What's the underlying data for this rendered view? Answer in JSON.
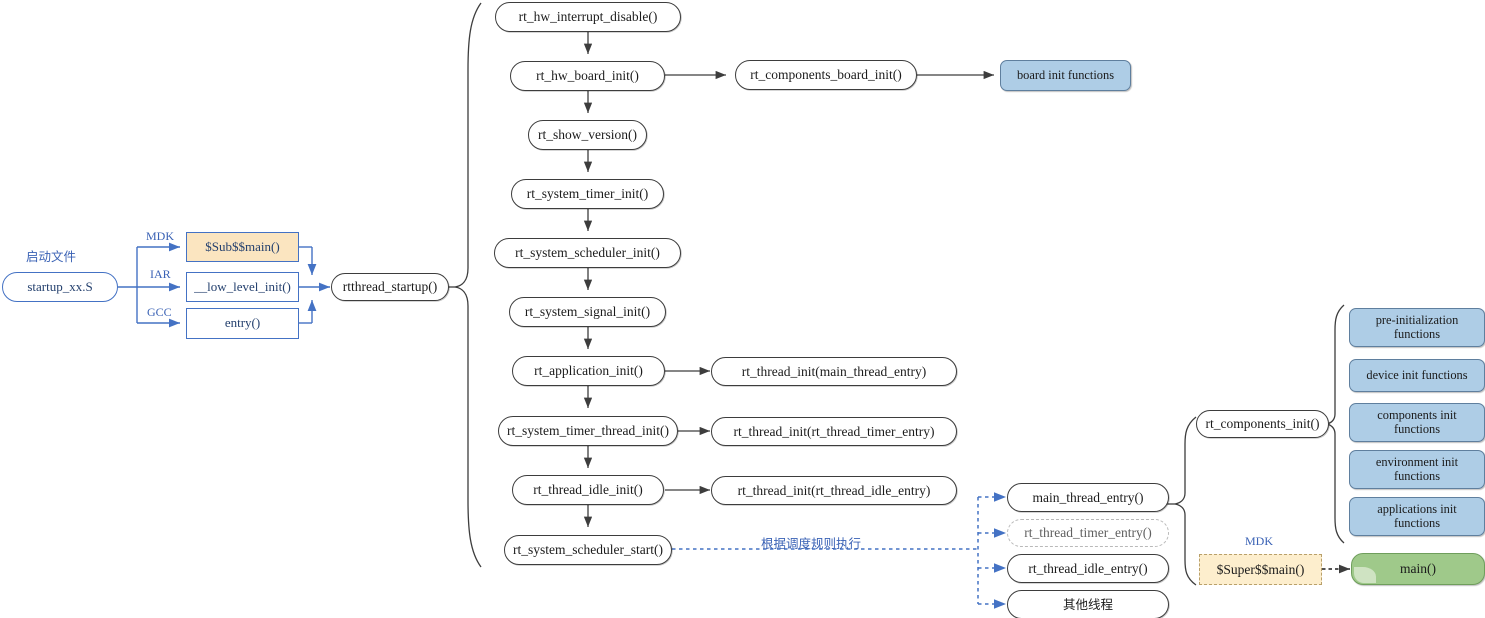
{
  "diagram": {
    "title": "RT-Thread startup flow",
    "colors": {
      "flow_arrow": "#3d3d3d",
      "blue_arrow": "#4472c4",
      "dotted_blue": "#4472c4",
      "blue_fill": "#aecde6",
      "green_fill": "#9fc98a",
      "yellow_fill": "#fbe5c0",
      "label_blue": "#3a62b5"
    }
  },
  "startup": {
    "file_label": "启动文件",
    "file_node": "startup_xx.S",
    "toolchains": [
      {
        "label": "MDK",
        "node": "$Sub$$main()"
      },
      {
        "label": "IAR",
        "node": "__low_level_init()"
      },
      {
        "label": "GCC",
        "node": "entry()"
      }
    ],
    "entry_node": "rtthread_startup()"
  },
  "main_flow": [
    "rt_hw_interrupt_disable()",
    "rt_hw_board_init()",
    "rt_show_version()",
    "rt_system_timer_init()",
    "rt_system_scheduler_init()",
    "rt_system_signal_init()",
    "rt_application_init()",
    "rt_system_timer_thread_init()",
    "rt_thread_idle_init()",
    "rt_system_scheduler_start()"
  ],
  "side_calls": {
    "board_init": "rt_components_board_init()",
    "board_init_functions": "board init functions",
    "thread_inits": [
      "rt_thread_init(main_thread_entry)",
      "rt_thread_init(rt_thread_timer_entry)",
      "rt_thread_init(rt_thread_idle_entry)"
    ]
  },
  "scheduler": {
    "edge_label": "根据调度规则执行",
    "threads": [
      "main_thread_entry()",
      "rt_thread_timer_entry()",
      "rt_thread_idle_entry()",
      "其他线程"
    ]
  },
  "components": {
    "node": "rt_components_init()",
    "init_groups": [
      "pre-initialization\nfunctions",
      "device init functions",
      "components init\nfunctions",
      "environment init\nfunctions",
      "applications init\nfunctions"
    ]
  },
  "app_main": {
    "toolchain_label": "MDK",
    "super_main": "$Super$$main()",
    "main": "main()"
  }
}
